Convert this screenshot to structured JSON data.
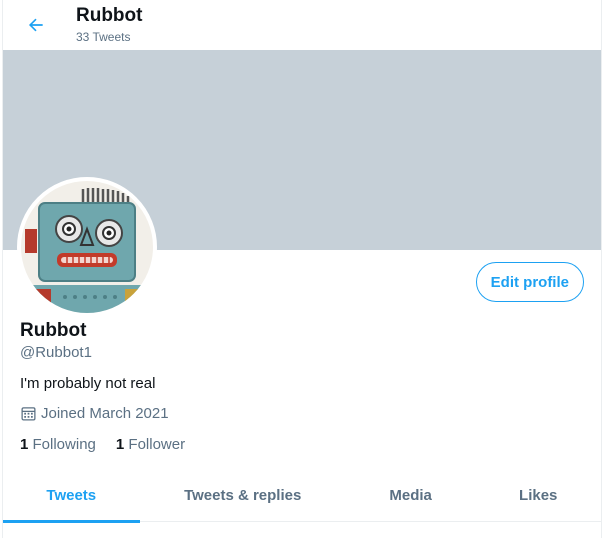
{
  "header": {
    "title": "Rubbot",
    "subtitle": "33 Tweets"
  },
  "profile": {
    "name": "Rubbot",
    "handle": "@Rubbot1",
    "bio": "I'm probably not real",
    "joined": "Joined March 2021",
    "edit_label": "Edit profile",
    "following_count": "1",
    "following_label": "Following",
    "followers_count": "1",
    "followers_label": "Follower"
  },
  "tabs": [
    {
      "label": "Tweets",
      "active": true
    },
    {
      "label": "Tweets & replies",
      "active": false
    },
    {
      "label": "Media",
      "active": false
    },
    {
      "label": "Likes",
      "active": false
    }
  ],
  "colors": {
    "accent": "#1da1f2",
    "banner": "#c6d0d8",
    "secondary_text": "#5b7083"
  },
  "icons": {
    "back": "arrow-left-icon",
    "calendar": "calendar-icon"
  }
}
